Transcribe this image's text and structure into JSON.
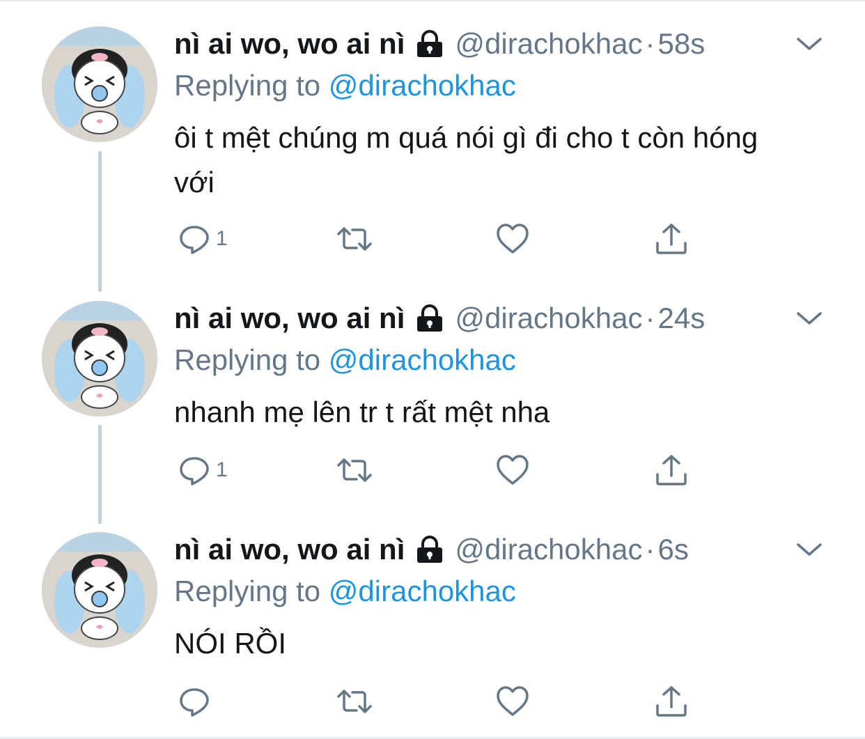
{
  "tweets": [
    {
      "display_name": "nì ai wo, wo ai nì",
      "handle": "@dirachokhac",
      "separator": "·",
      "time": "58s",
      "reply_prefix": "Replying to",
      "reply_handle": "@dirachokhac",
      "text": "ôi t mệt chúng m quá nói gì đi cho t còn hóng với",
      "reply_count": "1"
    },
    {
      "display_name": "nì ai wo, wo ai nì",
      "handle": "@dirachokhac",
      "separator": "·",
      "time": "24s",
      "reply_prefix": "Replying to",
      "reply_handle": "@dirachokhac",
      "text": "nhanh mẹ lên tr t rất mệt nha",
      "reply_count": "1"
    },
    {
      "display_name": "nì ai wo, wo ai nì",
      "handle": "@dirachokhac",
      "separator": "·",
      "time": "6s",
      "reply_prefix": "Replying to",
      "reply_handle": "@dirachokhac",
      "text": "NÓI RỒI",
      "reply_count": ""
    }
  ],
  "icons": {
    "lock": "lock-icon",
    "chevron": "chevron-down-icon",
    "reply": "reply-icon",
    "retweet": "retweet-icon",
    "like": "heart-icon",
    "share": "share-icon"
  },
  "colors": {
    "text_primary": "#14171a",
    "text_secondary": "#657786",
    "link": "#1b95e0",
    "thread_line": "#c4cfd6"
  }
}
